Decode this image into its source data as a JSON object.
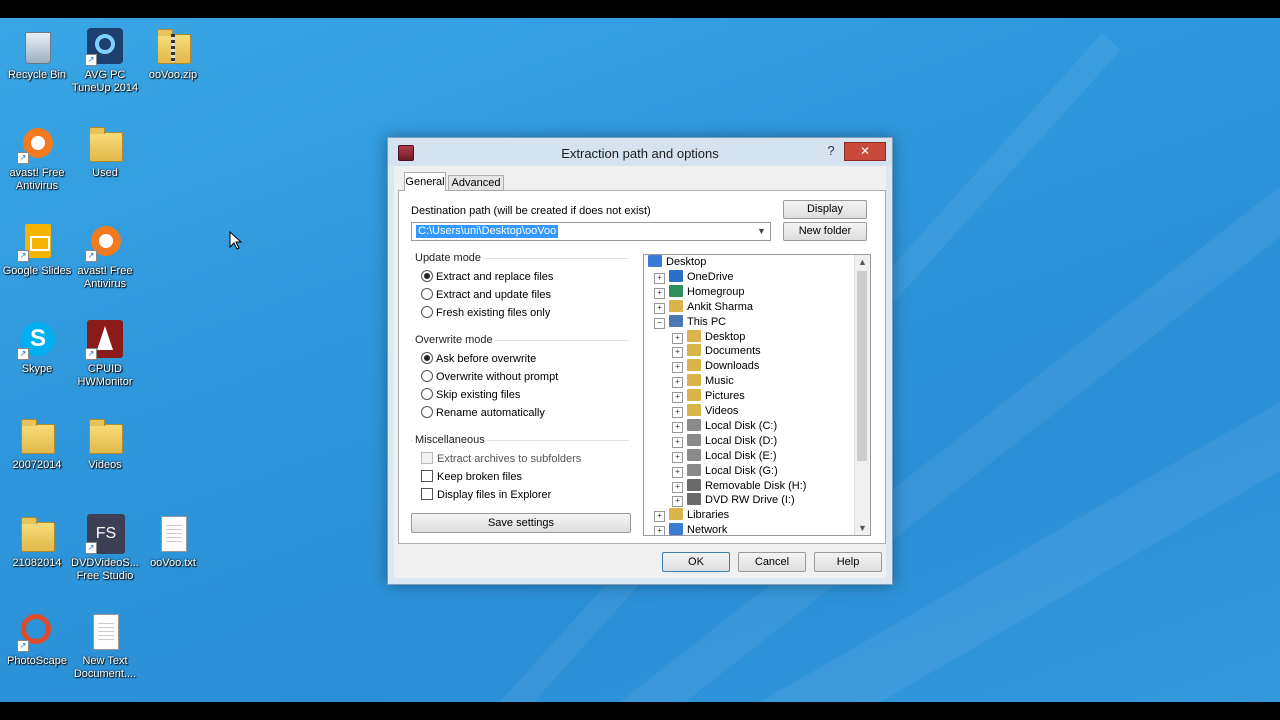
{
  "desktop": {
    "icons": [
      {
        "label": "Recycle Bin",
        "icon": "recycle-bin-icon"
      },
      {
        "label": "AVG PC TuneUp 2014",
        "icon": "avg-tuneup-icon"
      },
      {
        "label": "ooVoo.zip",
        "icon": "zip-folder-icon"
      },
      {
        "label": "avast! Free Antivirus",
        "icon": "avast-icon"
      },
      {
        "label": "Used",
        "icon": "folder-icon"
      },
      {
        "label": "Google Slides",
        "icon": "google-slides-icon"
      },
      {
        "label": "avast! Free Antivirus",
        "icon": "avast-icon"
      },
      {
        "label": "Skype",
        "icon": "skype-icon"
      },
      {
        "label": "CPUID HWMonitor",
        "icon": "hwmonitor-icon"
      },
      {
        "label": "20072014",
        "icon": "folder-icon"
      },
      {
        "label": "Videos",
        "icon": "folder-icon"
      },
      {
        "label": "21082014",
        "icon": "folder-icon"
      },
      {
        "label": "DVDVideoS... Free Studio",
        "icon": "free-studio-icon"
      },
      {
        "label": "ooVoo.txt",
        "icon": "text-file-icon"
      },
      {
        "label": "PhotoScape",
        "icon": "photoscape-icon"
      },
      {
        "label": "New Text Document....",
        "icon": "text-file-icon"
      }
    ]
  },
  "dialog": {
    "title": "Extraction path and options",
    "help_glyph": "?",
    "close_glyph": "✕",
    "tabs": [
      {
        "label": "General",
        "active": true
      },
      {
        "label": "Advanced",
        "active": false
      }
    ],
    "destination": {
      "label": "Destination path (will be created if does not exist)",
      "value": "C:\\Users\\uni\\Desktop\\ooVoo"
    },
    "buttons": {
      "display": "Display",
      "new_folder": "New folder",
      "save_settings": "Save settings",
      "ok": "OK",
      "cancel": "Cancel",
      "help": "Help"
    },
    "update_mode": {
      "title": "Update mode",
      "options": [
        {
          "label": "Extract and replace files",
          "selected": true
        },
        {
          "label": "Extract and update files",
          "selected": false
        },
        {
          "label": "Fresh existing files only",
          "selected": false
        }
      ]
    },
    "overwrite_mode": {
      "title": "Overwrite mode",
      "options": [
        {
          "label": "Ask before overwrite",
          "selected": true
        },
        {
          "label": "Overwrite without prompt",
          "selected": false
        },
        {
          "label": "Skip existing files",
          "selected": false
        },
        {
          "label": "Rename automatically",
          "selected": false
        }
      ]
    },
    "miscellaneous": {
      "title": "Miscellaneous",
      "options": [
        {
          "label": "Extract archives to subfolders",
          "checked": false,
          "disabled": true
        },
        {
          "label": "Keep broken files",
          "checked": false,
          "disabled": false
        },
        {
          "label": "Display files in Explorer",
          "checked": false,
          "disabled": false
        }
      ]
    },
    "tree": [
      {
        "label": "Desktop",
        "level": 0,
        "expander": "",
        "color": "#3a7bd5"
      },
      {
        "label": "OneDrive",
        "level": 1,
        "expander": "+",
        "color": "#2a6fc9"
      },
      {
        "label": "Homegroup",
        "level": 1,
        "expander": "+",
        "color": "#2f8f5a"
      },
      {
        "label": "Ankit Sharma",
        "level": 1,
        "expander": "+",
        "color": "#d9b44a"
      },
      {
        "label": "This PC",
        "level": 1,
        "expander": "−",
        "color": "#4a78b5"
      },
      {
        "label": "Desktop",
        "level": 2,
        "expander": "+",
        "color": "#d9b44a"
      },
      {
        "label": "Documents",
        "level": 2,
        "expander": "+",
        "color": "#d9b44a"
      },
      {
        "label": "Downloads",
        "level": 2,
        "expander": "+",
        "color": "#d9b44a"
      },
      {
        "label": "Music",
        "level": 2,
        "expander": "+",
        "color": "#d9b44a"
      },
      {
        "label": "Pictures",
        "level": 2,
        "expander": "+",
        "color": "#d9b44a"
      },
      {
        "label": "Videos",
        "level": 2,
        "expander": "+",
        "color": "#d9b44a"
      },
      {
        "label": "Local Disk (C:)",
        "level": 2,
        "expander": "+",
        "color": "#8a8a8a"
      },
      {
        "label": "Local Disk (D:)",
        "level": 2,
        "expander": "+",
        "color": "#8a8a8a"
      },
      {
        "label": "Local Disk (E:)",
        "level": 2,
        "expander": "+",
        "color": "#8a8a8a"
      },
      {
        "label": "Local Disk (G:)",
        "level": 2,
        "expander": "+",
        "color": "#8a8a8a"
      },
      {
        "label": "Removable Disk (H:)",
        "level": 2,
        "expander": "+",
        "color": "#6a6a6a"
      },
      {
        "label": "DVD RW Drive (I:)",
        "level": 2,
        "expander": "+",
        "color": "#6a6a6a"
      },
      {
        "label": "Libraries",
        "level": 1,
        "expander": "+",
        "color": "#d9b44a"
      },
      {
        "label": "Network",
        "level": 1,
        "expander": "+",
        "color": "#3a7bd5"
      }
    ]
  }
}
